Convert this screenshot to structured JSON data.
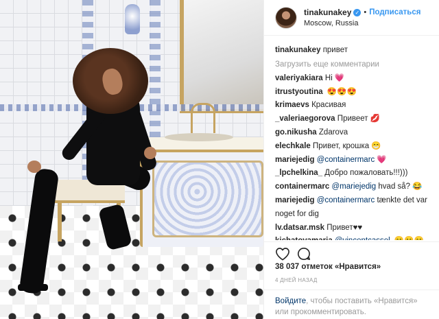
{
  "header": {
    "username": "tinakunakey",
    "verified_icon": "verified-badge-icon",
    "separator": "•",
    "follow_label": "Подписаться",
    "location": "Moscow, Russia"
  },
  "caption": {
    "username": "tinakunakey",
    "text": "привет"
  },
  "load_more_label": "Загрузить еще комментарии",
  "comments": [
    {
      "user": "valeriyakiara",
      "text": "Hi",
      "emoji": "💗"
    },
    {
      "user": "itrustyoutina",
      "text": "",
      "emoji": "😍😍😍"
    },
    {
      "user": "krimaevs",
      "text": "Красивая",
      "emoji": ""
    },
    {
      "user": "_valeriaegorova",
      "text": "Привеет",
      "emoji": "💋"
    },
    {
      "user": "go.nikusha",
      "text": "Zdarova",
      "emoji": ""
    },
    {
      "user": "elechkale",
      "text": "Привет, крошка",
      "emoji": "😁"
    },
    {
      "user": "mariejedig",
      "mention": "@containermarc",
      "text": "",
      "emoji": "💗"
    },
    {
      "user": "_lpchelkina_",
      "text": "Добро пожаловать!!!)))",
      "emoji": ""
    },
    {
      "user": "containermarc",
      "mention": "@mariejedig",
      "text": "hvad så?",
      "emoji": "😂"
    },
    {
      "user": "mariejedig",
      "mention": "@containermarc",
      "text": "tænkte det var noget for dig",
      "emoji": ""
    },
    {
      "user": "lv.datsar.msk",
      "text": "Привет♥♥",
      "emoji": ""
    },
    {
      "user": "kichatovamaria",
      "mention": "@vincentcassel",
      "text": ",",
      "emoji": "😁😁😁"
    }
  ],
  "actions": {
    "like_icon": "heart-icon",
    "comment_icon": "comment-icon"
  },
  "likes_text": "38 037 отметок «Нравится»",
  "time_text": "4 ДНЕЙ НАЗАД",
  "login_prompt": {
    "link_label": "Войдите",
    "text": ", чтобы поставить «Нравится» или прокомментировать."
  }
}
